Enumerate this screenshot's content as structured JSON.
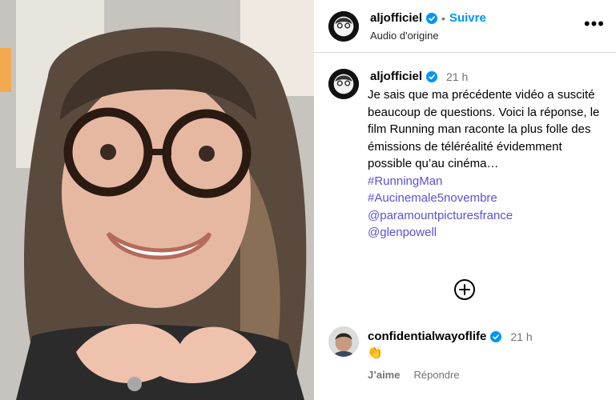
{
  "header": {
    "username": "aljofficiel",
    "separator": "•",
    "follow_label": "Suivre",
    "audio_label": "Audio d'origine",
    "more_label": "•••"
  },
  "post": {
    "username": "aljofficiel",
    "time": "21 h",
    "caption_text": "Je sais que ma précédente vidéo a suscité beaucoup de questions. Voici la réponse, le film Running man raconte la plus folle des émissions de téléréalité évidemment possible qu’au cinéma…",
    "tags": [
      "#RunningMan",
      "#Aucinemale5novembre",
      "@paramountpicturesfrance",
      "@glenpowell"
    ]
  },
  "comment": {
    "username": "confidentialwayoflife",
    "time": "21 h",
    "text": "👏",
    "like_label": "J’aime",
    "reply_label": "Répondre"
  },
  "colors": {
    "accent": "#0095f6",
    "link": "#5b51d8",
    "muted": "#737373"
  },
  "icons": {
    "verified": "verified-badge-icon",
    "add_comment": "plus-circle-icon",
    "more": "more-options-icon"
  }
}
